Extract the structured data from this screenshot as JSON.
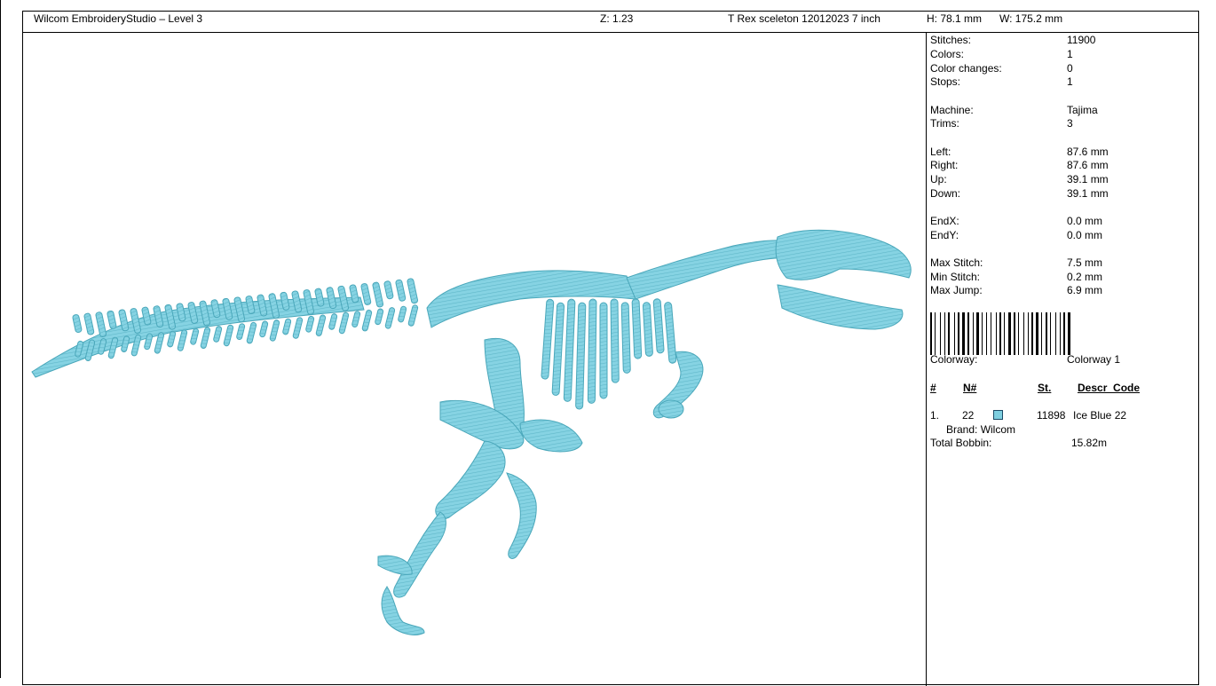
{
  "header": {
    "title": "Wilcom EmbroideryStudio – Level 3",
    "zoom": "Z: 1.23",
    "design": "T Rex sceleton 12012023 7 inch",
    "height": "H: 78.1 mm",
    "width": "W: 175.2 mm"
  },
  "stats": [
    {
      "label": "Stitches:",
      "value": "11900"
    },
    {
      "label": "Colors:",
      "value": "1"
    },
    {
      "label": "Color changes:",
      "value": "0"
    },
    {
      "label": "Stops:",
      "value": "1"
    },
    {
      "label": "Machine:",
      "value": "Tajima"
    },
    {
      "label": "Trims:",
      "value": "3"
    },
    {
      "label": "Left:",
      "value": "87.6 mm"
    },
    {
      "label": "Right:",
      "value": "87.6 mm"
    },
    {
      "label": "Up:",
      "value": "39.1 mm"
    },
    {
      "label": "Down:",
      "value": "39.1 mm"
    },
    {
      "label": "EndX:",
      "value": "0.0 mm"
    },
    {
      "label": "EndY:",
      "value": "0.0 mm"
    },
    {
      "label": "Max Stitch:",
      "value": "7.5 mm"
    },
    {
      "label": "Min Stitch:",
      "value": "0.2 mm"
    },
    {
      "label": "Max Jump:",
      "value": "6.9 mm"
    }
  ],
  "colorway": {
    "label": "Colorway:",
    "value": "Colorway 1"
  },
  "table": {
    "headers": {
      "num": "#",
      "n": "N#",
      "st": "St.",
      "desc": "Descr_Code"
    },
    "rows": [
      {
        "index": "1.",
        "n": "22",
        "st": "11898",
        "desc": "Ice Blue 22",
        "brand": "Brand: Wilcom",
        "color": "#7ecfe0"
      }
    ]
  },
  "bobbin": {
    "label": "Total Bobbin:",
    "value": "15.82m"
  },
  "design_color": "#7ecfe0",
  "design_shadow": "#3f9fb3",
  "barcode_icon": "barcode-icon",
  "design_icon": "trex-skeleton-icon"
}
